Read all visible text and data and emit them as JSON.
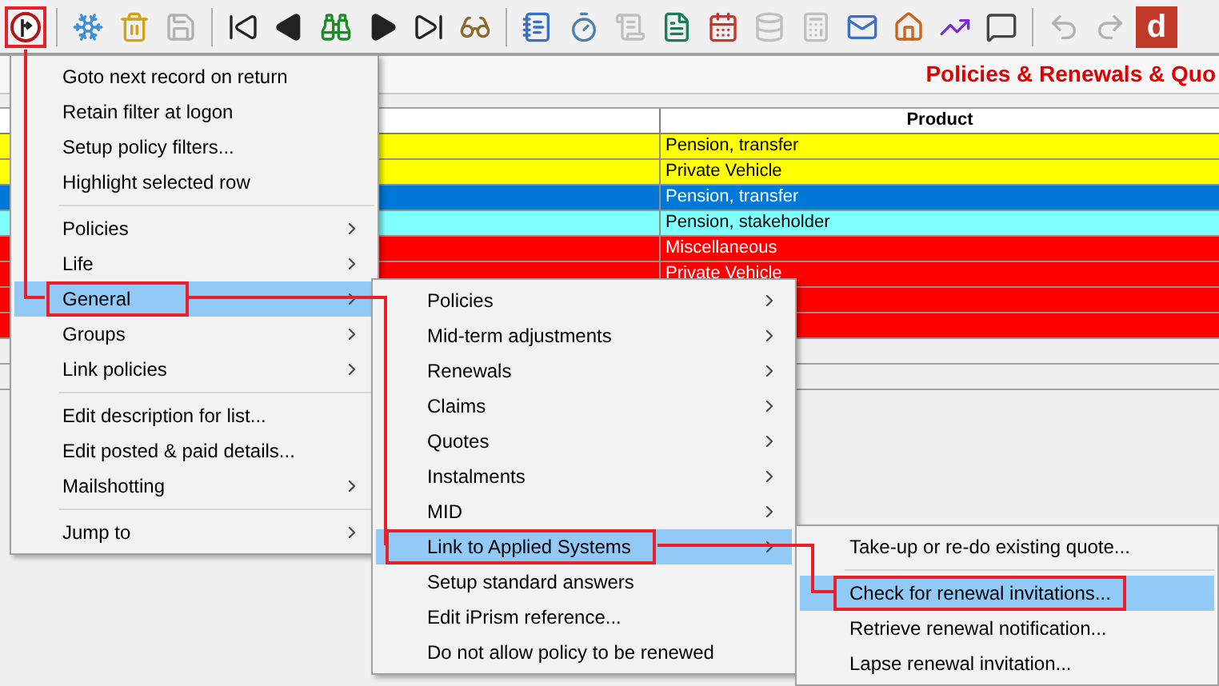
{
  "toolbar": {
    "groups": [
      [
        {
          "kind": "route",
          "disabled": false,
          "selected": true
        }
      ],
      [
        {
          "kind": "snowflake",
          "disabled": false,
          "selected": false
        },
        {
          "kind": "trash",
          "disabled": false,
          "selected": false
        },
        {
          "kind": "save",
          "disabled": true,
          "selected": false
        }
      ],
      [
        {
          "kind": "first",
          "disabled": false,
          "selected": false
        },
        {
          "kind": "prev",
          "disabled": false,
          "selected": false
        },
        {
          "kind": "binoculars",
          "disabled": false,
          "selected": false
        },
        {
          "kind": "next",
          "disabled": false,
          "selected": false
        },
        {
          "kind": "last",
          "disabled": false,
          "selected": false
        },
        {
          "kind": "glasses",
          "disabled": false,
          "selected": false
        }
      ],
      [
        {
          "kind": "notepad",
          "disabled": false,
          "selected": false
        },
        {
          "kind": "stopwatch",
          "disabled": false,
          "selected": false
        },
        {
          "kind": "scroll",
          "disabled": true,
          "selected": false
        },
        {
          "kind": "word",
          "disabled": false,
          "selected": false
        },
        {
          "kind": "calendar",
          "disabled": false,
          "selected": false
        },
        {
          "kind": "database",
          "disabled": true,
          "selected": false
        },
        {
          "kind": "calculator",
          "disabled": true,
          "selected": false
        },
        {
          "kind": "email",
          "disabled": false,
          "selected": false
        },
        {
          "kind": "house",
          "disabled": false,
          "selected": false
        },
        {
          "kind": "chart",
          "disabled": false,
          "selected": false
        },
        {
          "kind": "speech",
          "disabled": false,
          "selected": false
        }
      ],
      [
        {
          "kind": "undo",
          "disabled": true,
          "selected": false
        },
        {
          "kind": "redo",
          "disabled": true,
          "selected": false
        },
        {
          "kind": "logo",
          "label": "d",
          "disabled": false,
          "selected": false
        }
      ]
    ]
  },
  "title": "Policies & Renewals & Quo",
  "table": {
    "columns": [
      "Product"
    ],
    "rows": [
      {
        "product": "Pension, transfer",
        "color": "#ffff00"
      },
      {
        "product": "Private Vehicle",
        "color": "#ffff00"
      },
      {
        "product": "Pension, transfer",
        "color": "#0078d7"
      },
      {
        "product": "Pension, stakeholder",
        "color": "#80ffff"
      },
      {
        "product": "Miscellaneous",
        "color": "#ff0000"
      },
      {
        "product": "Private Vehicle",
        "color": "#ff0000"
      },
      {
        "color": "#ff0000"
      },
      {
        "color": "#ff0000"
      }
    ]
  },
  "menus": [
    {
      "items": [
        {
          "kind": "item",
          "label": "Goto next record on return",
          "submenu": false,
          "selected": false
        },
        {
          "kind": "item",
          "label": "Retain filter at logon",
          "submenu": false,
          "selected": false
        },
        {
          "kind": "item",
          "label": "Setup policy filters...",
          "submenu": false,
          "selected": false
        },
        {
          "kind": "item",
          "label": "Highlight selected row",
          "submenu": false,
          "selected": false
        },
        {
          "kind": "separator"
        },
        {
          "kind": "item",
          "label": "Policies",
          "submenu": true,
          "selected": false
        },
        {
          "kind": "item",
          "label": "Life",
          "submenu": true,
          "selected": false
        },
        {
          "kind": "item",
          "label": "General",
          "submenu": true,
          "selected": true
        },
        {
          "kind": "item",
          "label": "Groups",
          "submenu": true,
          "selected": false
        },
        {
          "kind": "item",
          "label": "Link policies",
          "submenu": true,
          "selected": false
        },
        {
          "kind": "separator"
        },
        {
          "kind": "item",
          "label": "Edit description for list...",
          "submenu": false,
          "selected": false
        },
        {
          "kind": "item",
          "label": "Edit posted & paid details...",
          "submenu": false,
          "selected": false
        },
        {
          "kind": "item",
          "label": "Mailshotting",
          "submenu": true,
          "selected": false
        },
        {
          "kind": "separator"
        },
        {
          "kind": "item",
          "label": "Jump to",
          "submenu": true,
          "selected": false
        }
      ]
    },
    {
      "items": [
        {
          "kind": "item",
          "label": "Policies",
          "submenu": true,
          "selected": false
        },
        {
          "kind": "item",
          "label": "Mid-term adjustments",
          "submenu": true,
          "selected": false
        },
        {
          "kind": "item",
          "label": "Renewals",
          "submenu": true,
          "selected": false
        },
        {
          "kind": "item",
          "label": "Claims",
          "submenu": true,
          "selected": false
        },
        {
          "kind": "item",
          "label": "Quotes",
          "submenu": true,
          "selected": false
        },
        {
          "kind": "item",
          "label": "Instalments",
          "submenu": true,
          "selected": false
        },
        {
          "kind": "item",
          "label": "MID",
          "submenu": true,
          "selected": false
        },
        {
          "kind": "item",
          "label": "Link to Applied Systems",
          "submenu": true,
          "selected": true
        },
        {
          "kind": "item",
          "label": "Setup standard answers",
          "submenu": false,
          "selected": false
        },
        {
          "kind": "item",
          "label": "Edit iPrism reference...",
          "submenu": false,
          "selected": false
        },
        {
          "kind": "item",
          "label": "Do not allow policy to be renewed",
          "submenu": false,
          "selected": false
        }
      ]
    },
    {
      "items": [
        {
          "kind": "item",
          "label": "Take-up or re-do existing quote...",
          "submenu": false,
          "selected": false
        },
        {
          "kind": "separator"
        },
        {
          "kind": "item",
          "label": "Check for renewal invitations...",
          "submenu": false,
          "selected": true
        },
        {
          "kind": "item",
          "label": "Retrieve renewal notification...",
          "submenu": false,
          "selected": false
        },
        {
          "kind": "item",
          "label": "Lapse renewal invitation...",
          "submenu": false,
          "selected": false
        }
      ]
    }
  ]
}
